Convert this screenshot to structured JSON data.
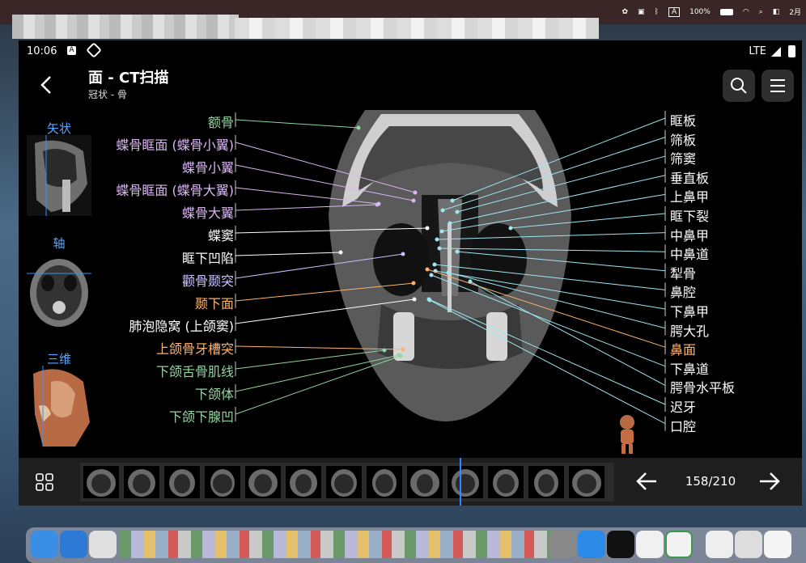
{
  "menubar": {
    "battery": "100%",
    "date": "2月"
  },
  "status": {
    "time": "10:06",
    "network": "LTE"
  },
  "header": {
    "title": "面 - CT扫描",
    "subtitle": "冠状 - 骨"
  },
  "views": [
    {
      "label": "矢状"
    },
    {
      "label": "轴"
    },
    {
      "label": "三维"
    }
  ],
  "labels_left": [
    {
      "text": "额骨",
      "color": "#8fd6a0"
    },
    {
      "text": "蝶骨眶面 (蝶骨小翼)",
      "color": "#d9b7f0"
    },
    {
      "text": "蝶骨小翼",
      "color": "#d9b7f0"
    },
    {
      "text": "蝶骨眶面 (蝶骨大翼)",
      "color": "#d9b7f0"
    },
    {
      "text": "蝶骨大翼",
      "color": "#d9b7f0"
    },
    {
      "text": "蝶窦",
      "color": "#ffffff"
    },
    {
      "text": "眶下凹陷",
      "color": "#ffffff"
    },
    {
      "text": "颧骨颞突",
      "color": "#c9c1ff"
    },
    {
      "text": "颞下面",
      "color": "#ffb36a"
    },
    {
      "text": "肺泡隐窝 (上颌窦)",
      "color": "#ffffff"
    },
    {
      "text": "上颌骨牙槽突",
      "color": "#ffb36a"
    },
    {
      "text": "下颌舌骨肌线",
      "color": "#8fd6a0"
    },
    {
      "text": "下颌体",
      "color": "#8fd6a0"
    },
    {
      "text": "下颌下腺凹",
      "color": "#8fd6a0"
    }
  ],
  "labels_right": [
    {
      "text": "眶板",
      "color": "#ffffff"
    },
    {
      "text": "筛板",
      "color": "#ffffff"
    },
    {
      "text": "筛窦",
      "color": "#ffffff"
    },
    {
      "text": "垂直板",
      "color": "#ffffff"
    },
    {
      "text": "上鼻甲",
      "color": "#ffffff"
    },
    {
      "text": "眶下裂",
      "color": "#ffffff"
    },
    {
      "text": "中鼻甲",
      "color": "#ffffff"
    },
    {
      "text": "中鼻道",
      "color": "#ffffff"
    },
    {
      "text": "犁骨",
      "color": "#ffffff"
    },
    {
      "text": "鼻腔",
      "color": "#ffffff"
    },
    {
      "text": "下鼻甲",
      "color": "#ffffff"
    },
    {
      "text": "腭大孔",
      "color": "#ffffff"
    },
    {
      "text": "鼻面",
      "color": "#ffb36a"
    },
    {
      "text": "下鼻道",
      "color": "#ffffff"
    },
    {
      "text": "腭骨水平板",
      "color": "#ffffff"
    },
    {
      "text": "迟牙",
      "color": "#ffffff"
    },
    {
      "text": "口腔",
      "color": "#ffffff"
    }
  ],
  "navigation": {
    "counter": "158/210"
  }
}
